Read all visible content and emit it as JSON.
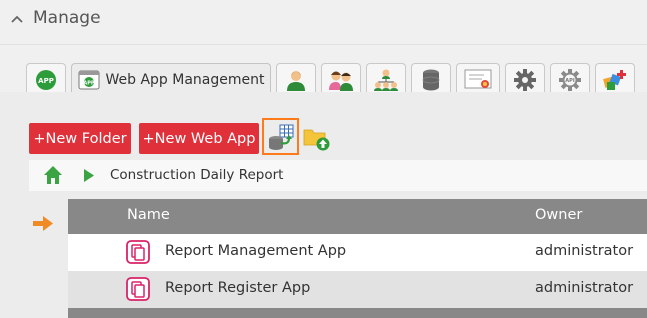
{
  "header": {
    "title": "Manage"
  },
  "tabs": {
    "active_label": "Web App Management",
    "items": [
      {
        "name": "app-icon-tab"
      },
      {
        "name": "web-app-management"
      },
      {
        "name": "user"
      },
      {
        "name": "groups"
      },
      {
        "name": "organization"
      },
      {
        "name": "database"
      },
      {
        "name": "certificate"
      },
      {
        "name": "settings"
      },
      {
        "name": "api"
      },
      {
        "name": "plugins"
      }
    ]
  },
  "toolbar": {
    "new_folder_label": "+New Folder",
    "new_web_app_label": "+New Web App"
  },
  "breadcrumb": {
    "current": "Construction Daily Report"
  },
  "table": {
    "columns": {
      "name": "Name",
      "owner": "Owner"
    },
    "rows": [
      {
        "name": "Report Management App",
        "owner": "administrator"
      },
      {
        "name": "Report Register App",
        "owner": "administrator"
      }
    ]
  },
  "colors": {
    "red_button": "#e0303a",
    "highlight_border": "#ff7a1a",
    "header_gray": "#888888",
    "app_icon_pink": "#d8236a",
    "home_green": "#3aa342",
    "arrow_orange": "#f08a24"
  }
}
